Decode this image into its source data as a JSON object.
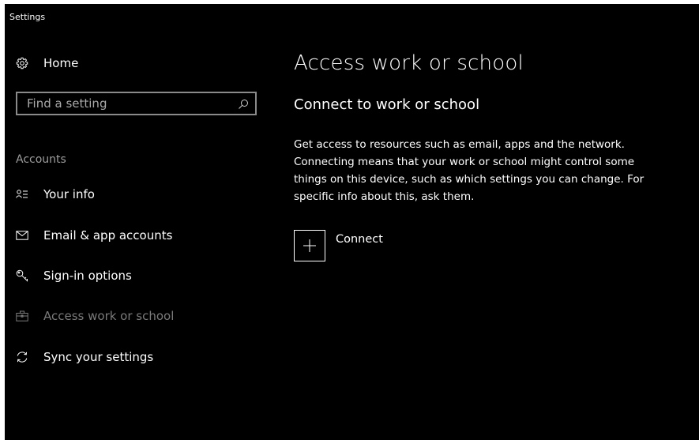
{
  "window": {
    "title": "Settings"
  },
  "sidebar": {
    "home_label": "Home",
    "search": {
      "placeholder": "Find a setting",
      "value": ""
    },
    "section_label": "Accounts",
    "items": [
      {
        "label": "Your info",
        "icon": "person-icon",
        "selected": false
      },
      {
        "label": "Email & app accounts",
        "icon": "mail-icon",
        "selected": false
      },
      {
        "label": "Sign-in options",
        "icon": "key-icon",
        "selected": false
      },
      {
        "label": "Access work or school",
        "icon": "briefcase-icon",
        "selected": true
      },
      {
        "label": "Sync your settings",
        "icon": "sync-icon",
        "selected": false
      }
    ]
  },
  "main": {
    "page_title": "Access work or school",
    "section_title": "Connect to work or school",
    "description": "Get access to resources such as email, apps and the network. Connecting means that your work or school might control some things on this device, such as which settings you can change. For specific info about this, ask them.",
    "connect_label": "Connect"
  },
  "colors": {
    "background": "#000000",
    "text": "#ffffff",
    "muted": "#9d9d9d",
    "selected": "#7a7a7a",
    "border": "#8a8a8a"
  }
}
